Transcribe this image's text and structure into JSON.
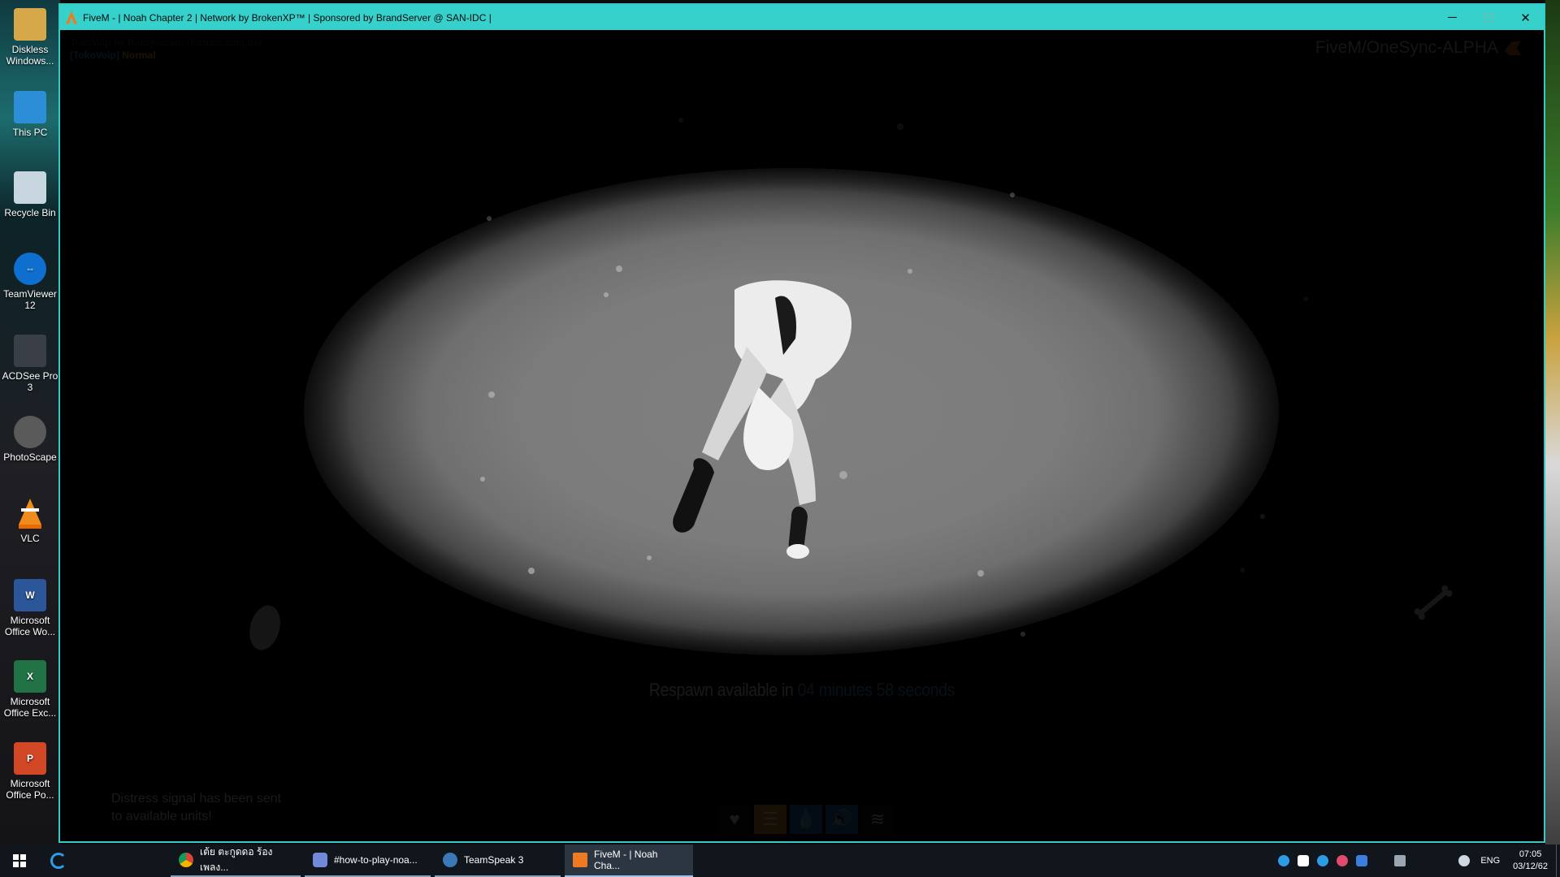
{
  "desktop": {
    "icons": [
      {
        "label": "Diskless Windows...",
        "icon": "folder-user-icon"
      },
      {
        "label": "This PC",
        "icon": "computer-icon"
      },
      {
        "label": "Recycle Bin",
        "icon": "recycle-bin-icon"
      },
      {
        "label": "TeamViewer 12",
        "icon": "teamviewer-icon"
      },
      {
        "label": "ACDSee Pro 3",
        "icon": "acdsee-icon"
      },
      {
        "label": "PhotoScape",
        "icon": "photoscape-icon"
      },
      {
        "label": "VLC",
        "icon": "vlc-icon"
      },
      {
        "label": "Microsoft Office Wo...",
        "icon": "word-icon"
      },
      {
        "label": "Microsoft Office Exc...",
        "icon": "excel-icon"
      },
      {
        "label": "Microsoft Office Po...",
        "icon": "powerpoint-icon"
      }
    ]
  },
  "window": {
    "title": "FiveM - | Noah Chapter 2 | Network by BrokenXP™ | Sponsored by BrandServer @ SAN-IDC |",
    "controls": {
      "minimize": "─",
      "maximize": "☐",
      "close": "✕"
    }
  },
  "game": {
    "voip_credit": "TokoVoip by Itokoyamato (forums.mng.us)",
    "voip_tag": "[TokoVoip]",
    "voip_mode": "Normal",
    "brand": "FiveM/OneSync-ALPHA",
    "respawn_prefix": "Respawn available in ",
    "respawn_time": "04 minutes 58 seconds",
    "distress_line1": "Distress signal has been sent",
    "distress_line2": "to available units!",
    "hud": [
      {
        "name": "health",
        "icon": "heart-icon",
        "glyph": "♥",
        "color": "#111111"
      },
      {
        "name": "food",
        "icon": "burger-icon",
        "glyph": "☰",
        "color": "#e69b1a"
      },
      {
        "name": "water",
        "icon": "water-drop-icon",
        "glyph": "💧",
        "color": "#1f7ccf"
      },
      {
        "name": "voice",
        "icon": "speaker-icon",
        "glyph": "🔊",
        "color": "#1f7ccf"
      },
      {
        "name": "stress",
        "icon": "waves-icon",
        "glyph": "≋",
        "color": "#111111"
      }
    ]
  },
  "taskbar": {
    "items": [
      {
        "label": "เต้ย ตะกูดดอ ร้องเพลง...",
        "icon": "chrome-icon",
        "color": "#e8b21f"
      },
      {
        "label": "#how-to-play-noa...",
        "icon": "discord-icon",
        "color": "#7289da"
      },
      {
        "label": "TeamSpeak 3",
        "icon": "teamspeak-icon",
        "color": "#3a78b8"
      },
      {
        "label": "FiveM - | Noah Cha...",
        "icon": "fivem-icon",
        "color": "#f07a22"
      }
    ],
    "language": "ENG",
    "time": "07:05",
    "date": "03/12/62"
  }
}
